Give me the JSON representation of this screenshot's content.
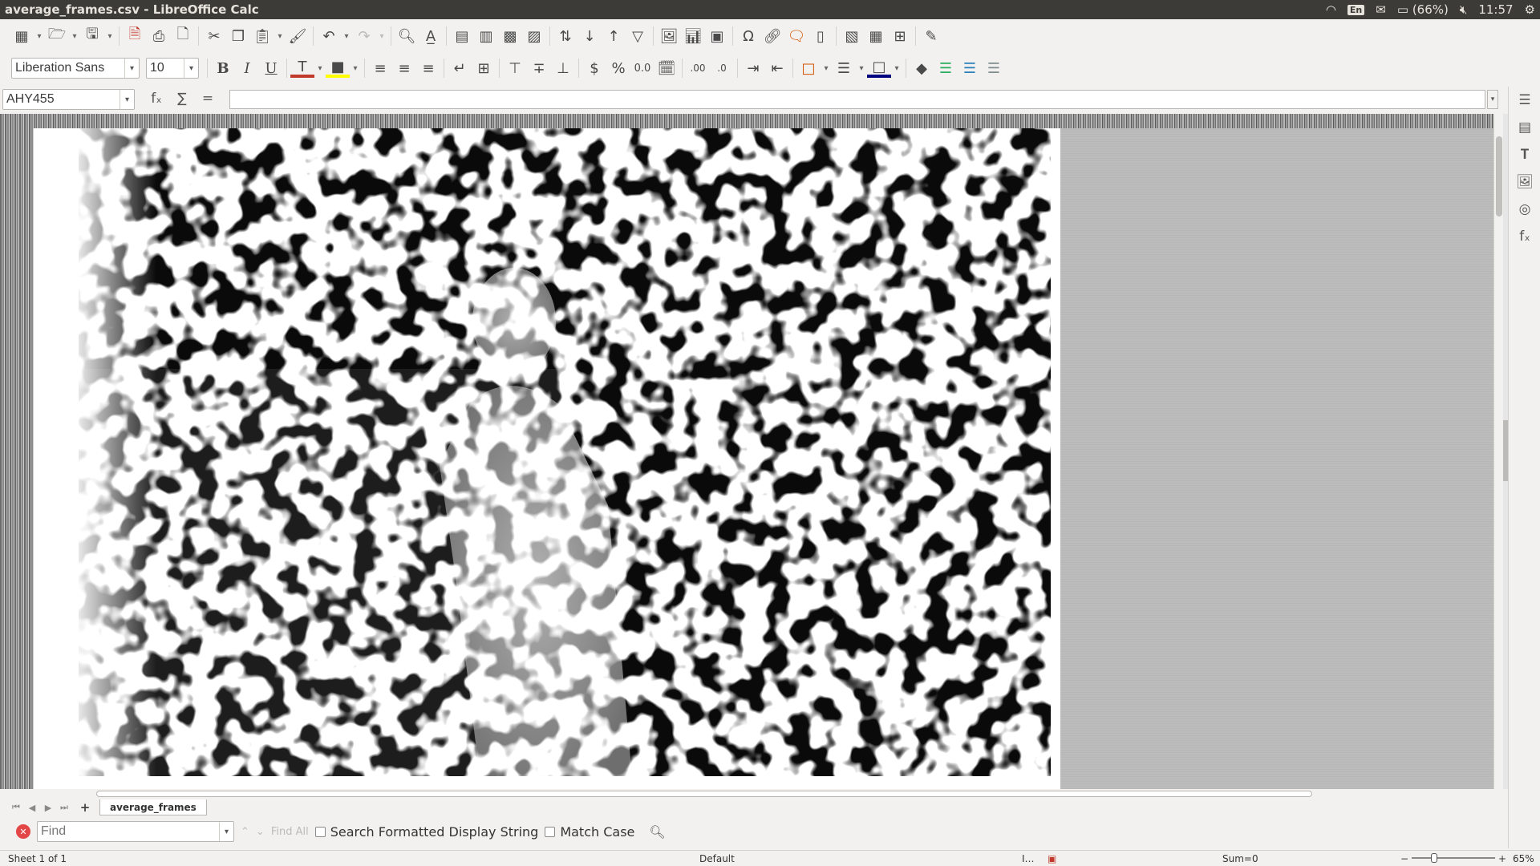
{
  "window": {
    "title": "average_frames.csv - LibreOffice Calc"
  },
  "tray": {
    "keyboard": "En",
    "battery": "(66%)",
    "clock": "11:57"
  },
  "format": {
    "font_name": "Liberation Sans",
    "font_size": "10"
  },
  "formula_bar": {
    "name_box": "AHY455",
    "content": ""
  },
  "sheet_tabs": {
    "active": "average_frames"
  },
  "find_toolbar": {
    "placeholder": "Find",
    "find_all": "Find All",
    "formatted_label": "Search Formatted Display String",
    "match_case_label": "Match Case"
  },
  "status_bar": {
    "sheet": "Sheet 1 of 1",
    "page_style": "Default",
    "sum": "Sum=0",
    "zoom": "65%"
  },
  "colors": {
    "title_bg": "#3c3b37",
    "font_color_swatch": "#c0392b",
    "highlight_swatch": "#ffff00",
    "border_swatch": "#000080"
  }
}
